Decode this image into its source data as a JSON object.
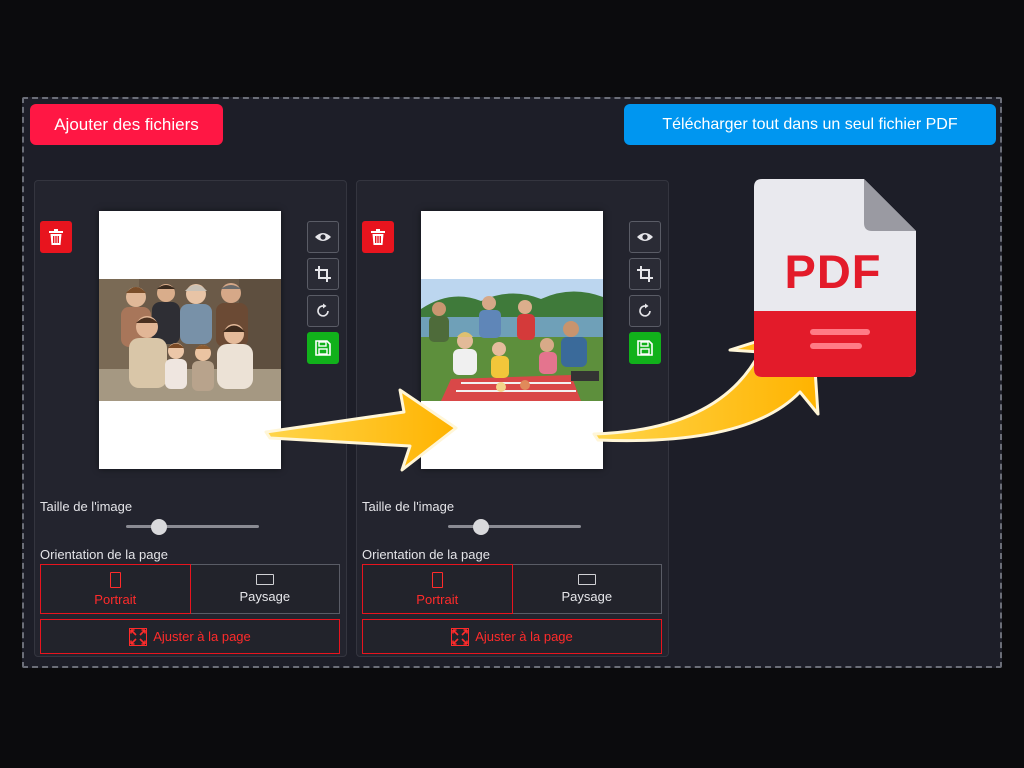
{
  "toolbar": {
    "add_files_label": "Ajouter des fichiers",
    "download_all_label": "Télécharger tout dans un seul fichier PDF"
  },
  "colors": {
    "add_button": "#ff1744",
    "download_button": "#0096f0",
    "delete_button": "#e8141e",
    "save_button": "#11b11b",
    "active_red": "#ff2b2b",
    "arrow_yellow": "#ffc107"
  },
  "cards": [
    {
      "photo": "family-portrait-indoor",
      "size_label": "Taille de l'image",
      "size_value": 0.25,
      "orientation_label": "Orientation de la page",
      "portrait_label": "Portrait",
      "landscape_label": "Paysage",
      "selected_orientation": "Portrait",
      "fit_label": "Ajuster à la page",
      "tools": [
        "eye-icon",
        "crop-icon",
        "rotate-icon",
        "save-icon"
      ]
    },
    {
      "photo": "family-picnic-lake",
      "size_label": "Taille de l'image",
      "size_value": 0.25,
      "orientation_label": "Orientation de la page",
      "portrait_label": "Portrait",
      "landscape_label": "Paysage",
      "selected_orientation": "Portrait",
      "fit_label": "Ajuster à la page",
      "tools": [
        "eye-icon",
        "crop-icon",
        "rotate-icon",
        "save-icon"
      ]
    }
  ],
  "pdf_icon": {
    "label": "PDF"
  }
}
